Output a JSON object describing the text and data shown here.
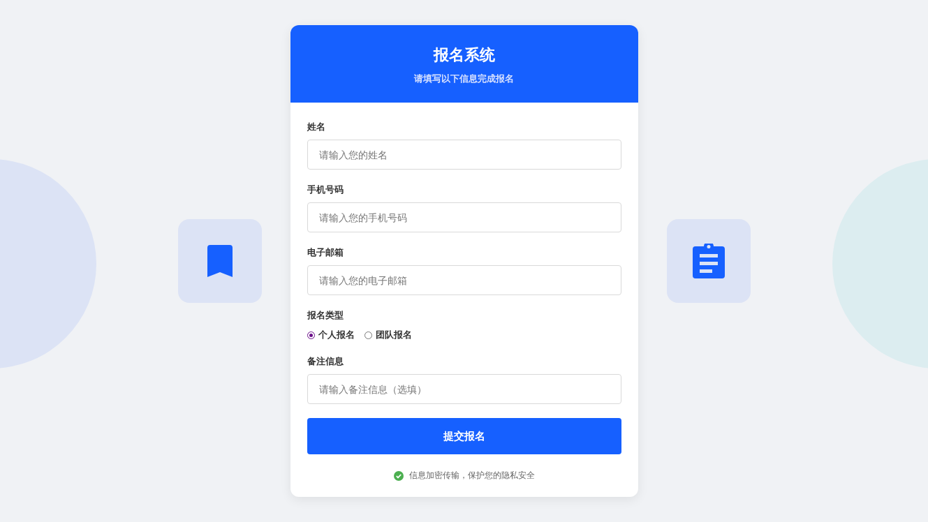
{
  "header": {
    "title": "报名系统",
    "subtitle": "请填写以下信息完成报名"
  },
  "fields": [
    {
      "kind": "text",
      "label": "姓名",
      "placeholder": "请输入您的姓名"
    },
    {
      "kind": "text",
      "label": "手机号码",
      "placeholder": "请输入您的手机号码"
    },
    {
      "kind": "text",
      "label": "电子邮箱",
      "placeholder": "请输入您的电子邮箱"
    },
    {
      "kind": "radio",
      "label": "报名类型",
      "options": [
        {
          "label": "个人报名",
          "selected": true
        },
        {
          "label": "团队报名",
          "selected": false
        }
      ]
    },
    {
      "kind": "text",
      "label": "备注信息",
      "placeholder": "请输入备注信息（选填）"
    }
  ],
  "submit": "提交报名",
  "note": "信息加密传输，保护您的隐私安全"
}
